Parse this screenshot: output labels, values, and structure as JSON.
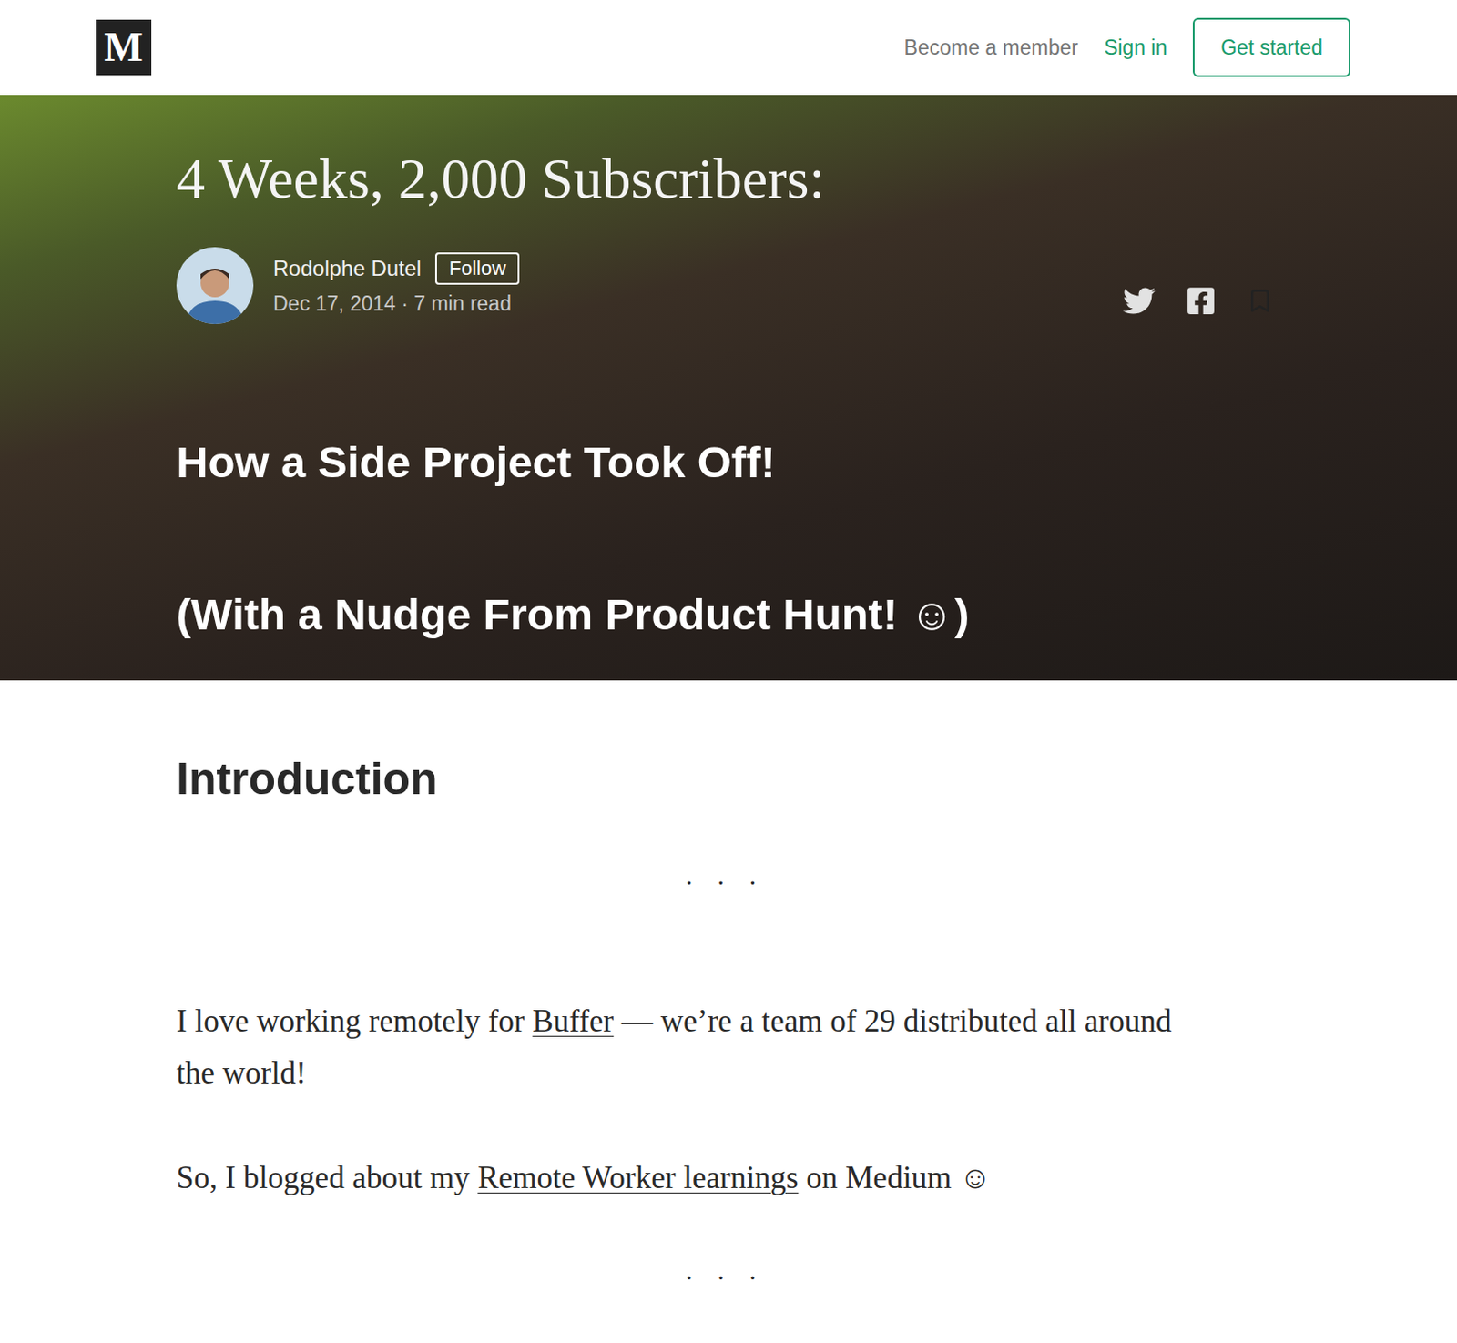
{
  "header": {
    "logo": "M",
    "nav": [
      {
        "label": "Become a member",
        "accent": false
      },
      {
        "label": "Sign in",
        "accent": true
      }
    ],
    "cta": "Get started"
  },
  "hero": {
    "title": "4 Weeks, 2,000 Subscribers:",
    "author": {
      "name": "Rodolphe Dutel",
      "follow": "Follow",
      "meta": "Dec 17, 2014 · 7 min read"
    },
    "subtitles": [
      "How a Side Project Took Off!",
      "(With a Nudge From Product Hunt! ☺)"
    ]
  },
  "article": {
    "heading": "Introduction",
    "separator": "· · ·",
    "paragraphs": [
      [
        {
          "text": "I love working remotely for ",
          "link": false
        },
        {
          "text": "Buffer",
          "link": true
        },
        {
          "text": " — we’re a team of 29 distributed all around the world!",
          "link": false
        }
      ],
      [
        {
          "text": "So, I blogged about my ",
          "link": false
        },
        {
          "text": "Remote Worker learnings",
          "link": true
        },
        {
          "text": " on Medium ☺",
          "link": false
        }
      ]
    ]
  }
}
